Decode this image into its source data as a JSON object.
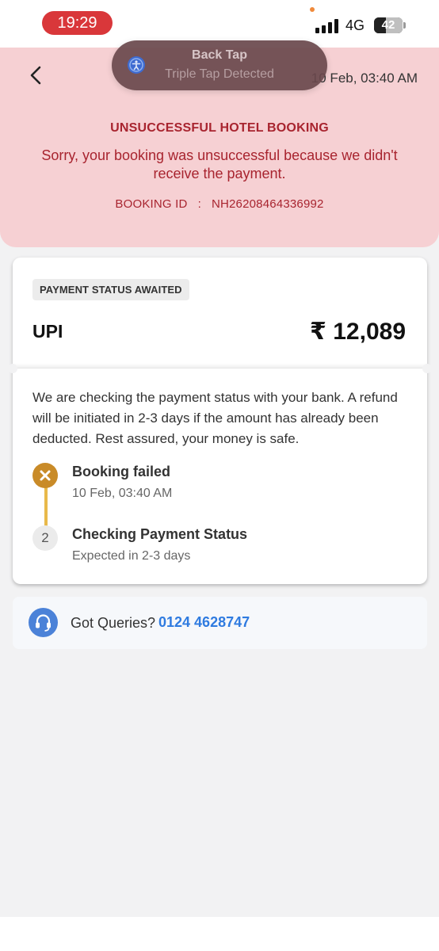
{
  "status_bar": {
    "time": "19:29",
    "network": "4G",
    "battery": "42",
    "battery_level": 0.42
  },
  "header": {
    "date": "10 Feb, 03:40 AM",
    "title": "UNSUCCESSFUL HOTEL BOOKING",
    "message": "Sorry, your booking was unsuccessful because we didn't receive the payment.",
    "booking_id_label": "BOOKING ID",
    "booking_id_sep": ":",
    "booking_id": "NH26208464336992"
  },
  "toast": {
    "title": "Back Tap",
    "subtitle": "Triple Tap Detected"
  },
  "payment": {
    "status_chip": "PAYMENT STATUS AWAITED",
    "method": "UPI",
    "amount": "₹ 12,089",
    "info": "We are checking the payment status with your bank.  A refund will be initiated in 2-3 days if the amount has already been deducted.  Rest assured, your money is safe.",
    "steps": [
      {
        "title": "Booking failed",
        "subtitle": "10 Feb, 03:40 AM",
        "icon": "close-icon"
      },
      {
        "number": "2",
        "title": "Checking Payment Status",
        "subtitle": "Expected in 2-3 days"
      }
    ]
  },
  "queries": {
    "label": "Got Queries?",
    "phone": "0124 4628747",
    "icon": "headset-icon"
  },
  "colors": {
    "header_bg": "#f6d0d3",
    "error_red": "#a8242f",
    "timeline_gold": "#c98b28",
    "link_blue": "#2f7be0"
  }
}
